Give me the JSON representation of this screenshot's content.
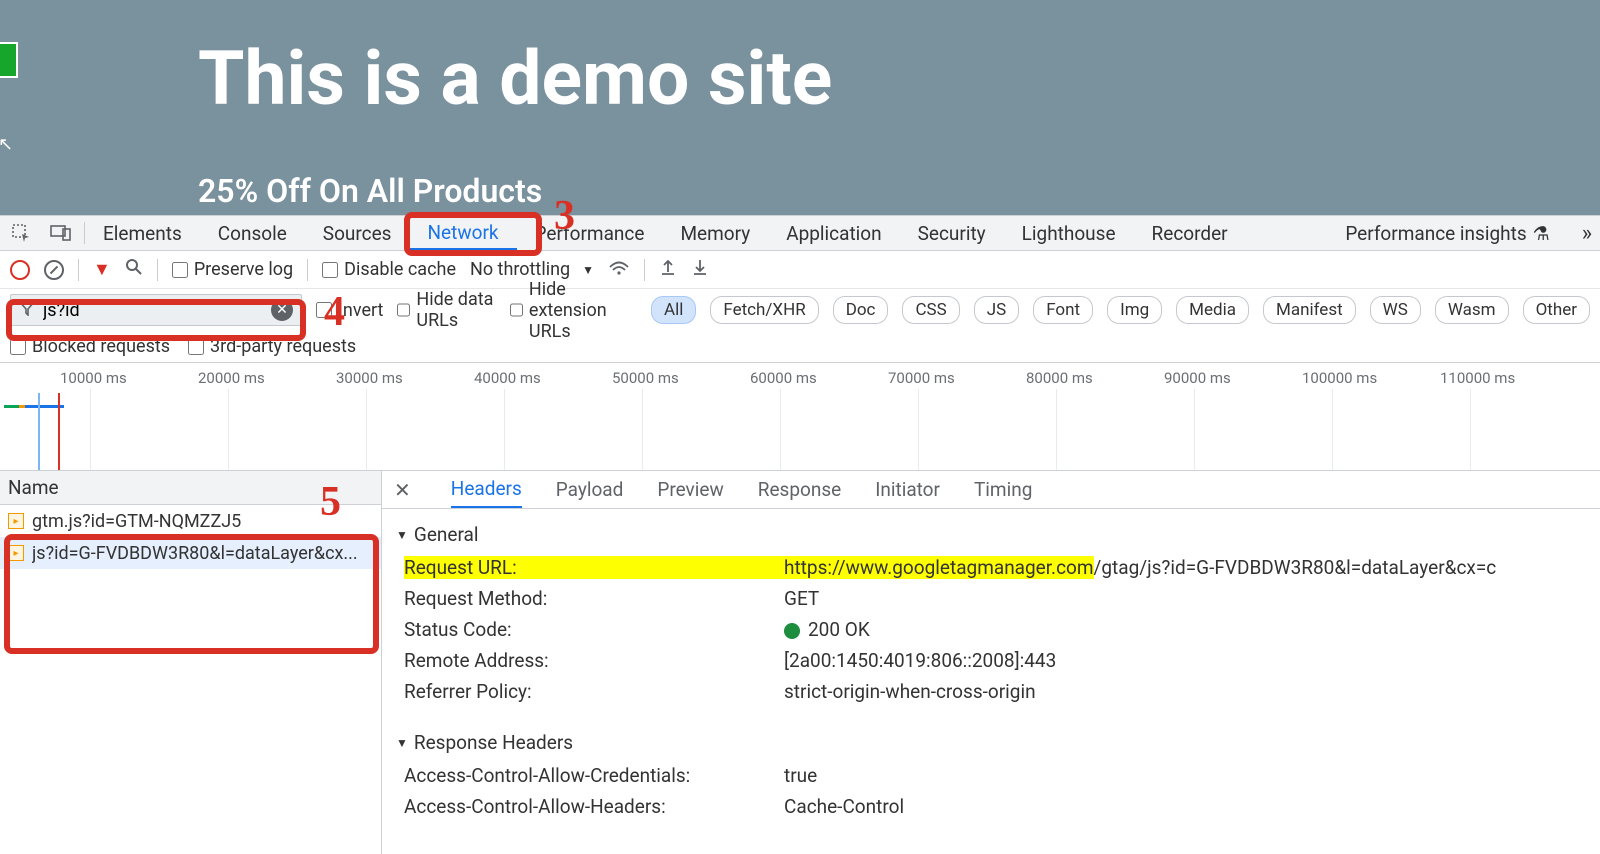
{
  "page": {
    "title": "This is a demo site",
    "subtitle": "25% Off On All Products"
  },
  "devtools_tabs": [
    "Elements",
    "Console",
    "Sources",
    "Network",
    "Performance",
    "Memory",
    "Application",
    "Security",
    "Lighthouse",
    "Recorder",
    "Performance insights"
  ],
  "active_devtools_tab": "Network",
  "toolbar1": {
    "preserve_log": "Preserve log",
    "disable_cache": "Disable cache",
    "throttling": "No throttling"
  },
  "toolbar2": {
    "filter_value": "js?id",
    "invert": "Invert",
    "hide_data": "Hide data URLs",
    "hide_ext": "Hide extension URLs",
    "filters": [
      "All",
      "Fetch/XHR",
      "Doc",
      "CSS",
      "JS",
      "Font",
      "Img",
      "Media",
      "Manifest",
      "WS",
      "Wasm",
      "Other"
    ]
  },
  "toolbar3": {
    "blocked": "Blocked requests",
    "third_party": "3rd-party requests"
  },
  "timeline_ticks": [
    "10000 ms",
    "20000 ms",
    "30000 ms",
    "40000 ms",
    "50000 ms",
    "60000 ms",
    "70000 ms",
    "80000 ms",
    "90000 ms",
    "100000 ms",
    "110000 ms"
  ],
  "requests": {
    "header": "Name",
    "rows": [
      {
        "name": "gtm.js?id=GTM-NQMZZJ5"
      },
      {
        "name": "js?id=G-FVDBDW3R80&l=dataLayer&cx..."
      }
    ]
  },
  "detail_tabs": [
    "Headers",
    "Payload",
    "Preview",
    "Response",
    "Initiator",
    "Timing"
  ],
  "general_label": "General",
  "general": [
    {
      "k": "Request URL:",
      "v_pre": "https://www.googletagmanager.com",
      "v_post": "/gtag/js?id=G-FVDBDW3R80&l=dataLayer&cx=c",
      "hl": true
    },
    {
      "k": "Request Method:",
      "v": "GET"
    },
    {
      "k": "Status Code:",
      "v": "200 OK",
      "dot": true
    },
    {
      "k": "Remote Address:",
      "v": "[2a00:1450:4019:806::2008]:443"
    },
    {
      "k": "Referrer Policy:",
      "v": "strict-origin-when-cross-origin"
    }
  ],
  "response_headers_label": "Response Headers",
  "response_headers": [
    {
      "k": "Access-Control-Allow-Credentials:",
      "v": "true"
    },
    {
      "k": "Access-Control-Allow-Headers:",
      "v": "Cache-Control"
    }
  ],
  "annotations": {
    "n3": "3",
    "n4": "4",
    "n5": "5"
  }
}
